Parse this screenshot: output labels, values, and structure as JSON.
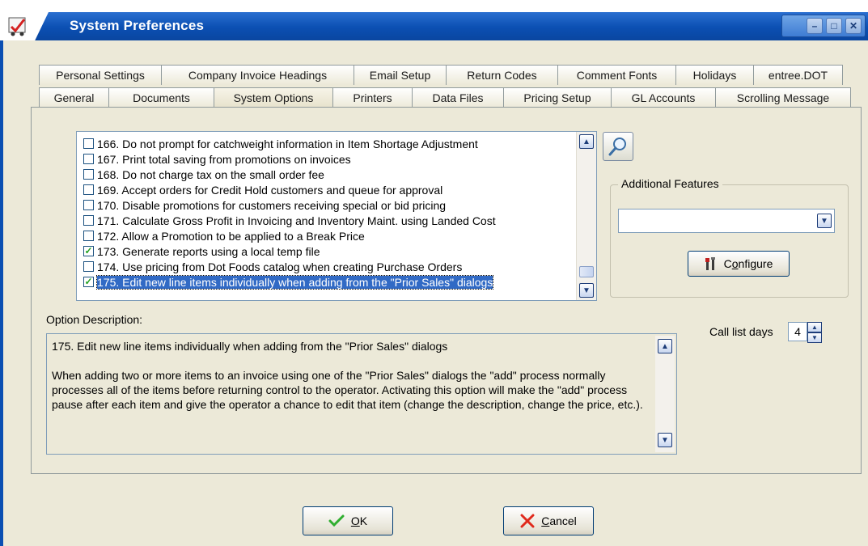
{
  "window": {
    "title": "System Preferences"
  },
  "tabs_top": [
    {
      "label": "Personal Settings"
    },
    {
      "label": "Company Invoice Headings"
    },
    {
      "label": "Email Setup"
    },
    {
      "label": "Return Codes"
    },
    {
      "label": "Comment Fonts"
    },
    {
      "label": "Holidays"
    },
    {
      "label": "entree.DOT"
    }
  ],
  "tabs_bottom": [
    {
      "label": "General"
    },
    {
      "label": "Documents"
    },
    {
      "label": "System Options",
      "active": true
    },
    {
      "label": "Printers"
    },
    {
      "label": "Data Files"
    },
    {
      "label": "Pricing Setup"
    },
    {
      "label": "GL Accounts"
    },
    {
      "label": "Scrolling Message"
    }
  ],
  "options": [
    {
      "label": "166. Do not prompt for catchweight information in Item Shortage Adjustment",
      "checked": false
    },
    {
      "label": "167. Print total saving from promotions on invoices",
      "checked": false
    },
    {
      "label": "168. Do not charge tax on the small order fee",
      "checked": false
    },
    {
      "label": "169. Accept orders for Credit Hold customers and queue for approval",
      "checked": false
    },
    {
      "label": "170. Disable promotions for customers receiving special or bid pricing",
      "checked": false
    },
    {
      "label": "171. Calculate Gross Profit in Invoicing and Inventory Maint. using Landed Cost",
      "checked": false
    },
    {
      "label": "172. Allow a Promotion to be applied to a Break Price",
      "checked": false
    },
    {
      "label": "173. Generate reports using a local temp file",
      "checked": true
    },
    {
      "label": "174. Use pricing from Dot Foods catalog when creating Purchase Orders",
      "checked": false
    },
    {
      "label": "175. Edit new line items individually when adding from the \"Prior Sales\" dialogs",
      "checked": true,
      "selected": true
    }
  ],
  "additional_features": {
    "title": "Additional Features",
    "selected": "",
    "configure_pre": "C",
    "configure_u": "o",
    "configure_post": "nfigure"
  },
  "description": {
    "label": "Option Description:",
    "title": "175. Edit new line items individually when adding from the \"Prior Sales\" dialogs",
    "body": "When adding two or more items to an invoice using one of the \"Prior Sales\" dialogs the \"add\" process normally processes all of the items before returning control to the operator. Activating this option will make the \"add\" process pause after each item and give the operator a chance to edit that item (change the description, change the price, etc.)."
  },
  "call_list": {
    "label": "Call list days",
    "value": "4"
  },
  "buttons": {
    "ok_u": "O",
    "ok_post": "K",
    "cancel_u": "C",
    "cancel_post": "ancel"
  },
  "colors": {
    "titlebar": "#0b4fb2",
    "selection": "#316ac5",
    "check": "#21a121",
    "cancel_x": "#e02a1c",
    "ok_check": "#2fae2f"
  }
}
